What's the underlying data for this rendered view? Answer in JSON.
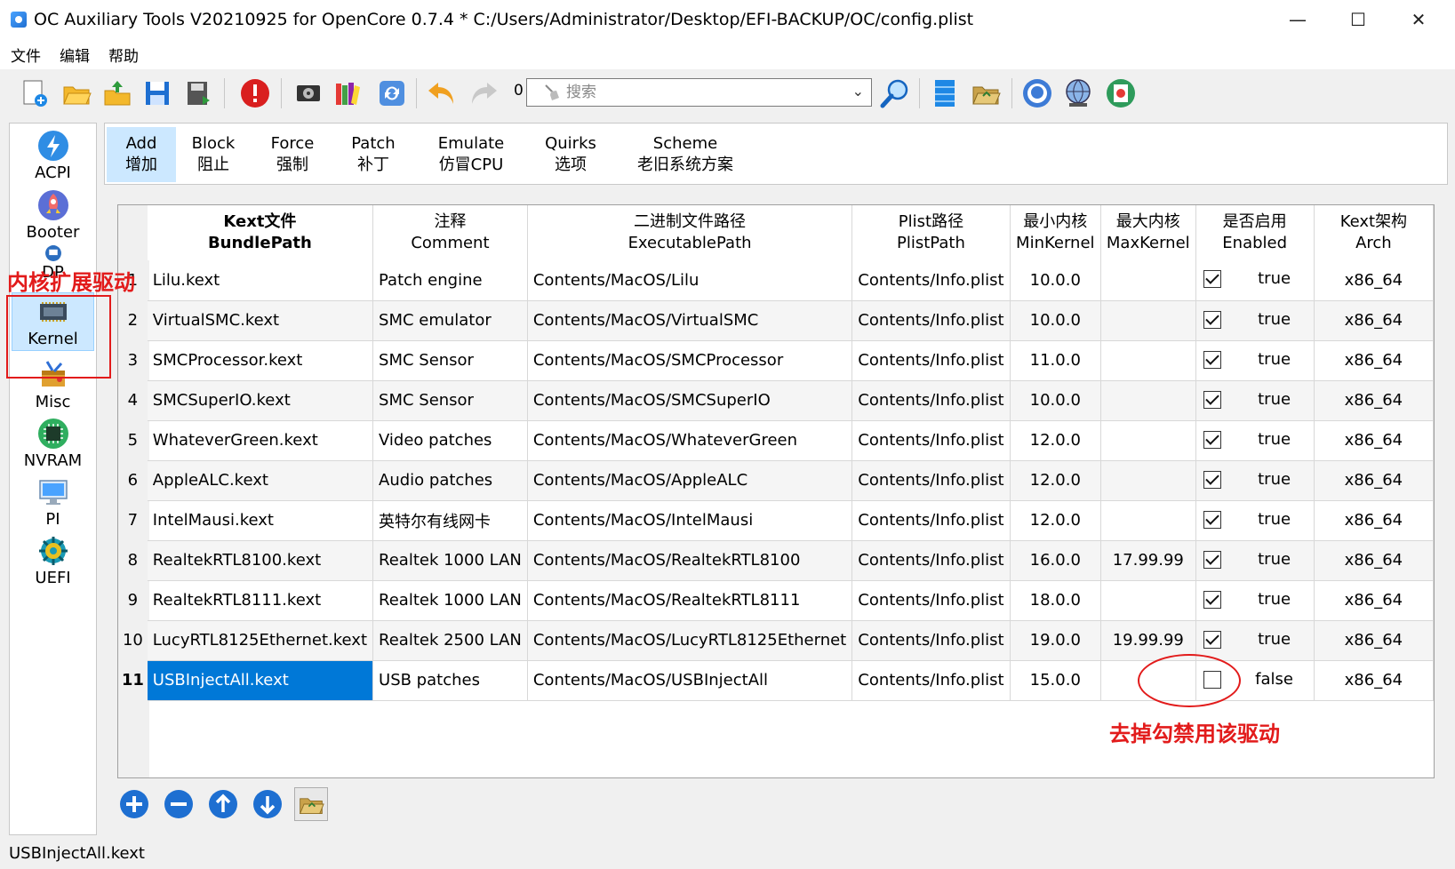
{
  "window": {
    "title": "OC Auxiliary Tools   V20210925 for OpenCore 0.7.4 *  C:/Users/Administrator/Desktop/EFI-BACKUP/OC/config.plist",
    "minimize": "—",
    "maximize": "☐",
    "close": "✕"
  },
  "menu": [
    "文件",
    "编辑",
    "帮助"
  ],
  "toolbar": {
    "search_count": "0",
    "search_placeholder": "搜索",
    "search_dropdown": "⌄",
    "icons": [
      "new-file-icon",
      "open-folder-icon",
      "upload-folder-icon",
      "save-icon",
      "save-as-icon",
      "stop-icon",
      "disk-icon",
      "library-icon",
      "refresh-icon",
      "undo-icon",
      "redo-icon",
      "search-icon",
      "database-icon",
      "folder-open-icon",
      "github-icon",
      "globe-icon",
      "info-icon"
    ]
  },
  "sidebar": {
    "items": [
      {
        "label": "ACPI",
        "icon": "lightning-icon"
      },
      {
        "label": "Booter",
        "icon": "rocket-icon"
      },
      {
        "label": "DP",
        "icon": "display-icon"
      },
      {
        "label": "Kernel",
        "icon": "chip-icon"
      },
      {
        "label": "Misc",
        "icon": "toolbox-icon"
      },
      {
        "label": "NVRAM",
        "icon": "memory-icon"
      },
      {
        "label": "PI",
        "icon": "monitor-icon"
      },
      {
        "label": "UEFI",
        "icon": "uefi-icon"
      }
    ],
    "active": "Kernel"
  },
  "tabs": [
    {
      "en": "Add",
      "zh": "增加"
    },
    {
      "en": "Block",
      "zh": "阻止"
    },
    {
      "en": "Force",
      "zh": "强制"
    },
    {
      "en": "Patch",
      "zh": "补丁"
    },
    {
      "en": "Emulate",
      "zh": "仿冒CPU"
    },
    {
      "en": "Quirks",
      "zh": "选项"
    },
    {
      "en": "Scheme",
      "zh": "老旧系统方案"
    }
  ],
  "table": {
    "headers": [
      {
        "zh": "Kext文件",
        "en": "BundlePath"
      },
      {
        "zh": "注释",
        "en": "Comment"
      },
      {
        "zh": "二进制文件路径",
        "en": "ExecutablePath"
      },
      {
        "zh": "Plist路径",
        "en": "PlistPath"
      },
      {
        "zh": "最小内核",
        "en": "MinKernel"
      },
      {
        "zh": "最大内核",
        "en": "MaxKernel"
      },
      {
        "zh": "是否启用",
        "en": "Enabled"
      },
      {
        "zh": "Kext架构",
        "en": "Arch"
      }
    ],
    "rows": [
      {
        "n": "1",
        "bundle": "Lilu.kext",
        "comment": "Patch engine",
        "exec": "Contents/MacOS/Lilu",
        "plist": "Contents/Info.plist",
        "min": "10.0.0",
        "max": "",
        "enabled": "true",
        "checked": true,
        "arch": "x86_64"
      },
      {
        "n": "2",
        "bundle": "VirtualSMC.kext",
        "comment": "SMC emulator",
        "exec": "Contents/MacOS/VirtualSMC",
        "plist": "Contents/Info.plist",
        "min": "10.0.0",
        "max": "",
        "enabled": "true",
        "checked": true,
        "arch": "x86_64"
      },
      {
        "n": "3",
        "bundle": "SMCProcessor.kext",
        "comment": "SMC Sensor",
        "exec": "Contents/MacOS/SMCProcessor",
        "plist": "Contents/Info.plist",
        "min": "11.0.0",
        "max": "",
        "enabled": "true",
        "checked": true,
        "arch": "x86_64"
      },
      {
        "n": "4",
        "bundle": "SMCSuperIO.kext",
        "comment": "SMC Sensor",
        "exec": "Contents/MacOS/SMCSuperIO",
        "plist": "Contents/Info.plist",
        "min": "10.0.0",
        "max": "",
        "enabled": "true",
        "checked": true,
        "arch": "x86_64"
      },
      {
        "n": "5",
        "bundle": "WhateverGreen.kext",
        "comment": "Video patches",
        "exec": "Contents/MacOS/WhateverGreen",
        "plist": "Contents/Info.plist",
        "min": "12.0.0",
        "max": "",
        "enabled": "true",
        "checked": true,
        "arch": "x86_64"
      },
      {
        "n": "6",
        "bundle": "AppleALC.kext",
        "comment": "Audio patches",
        "exec": "Contents/MacOS/AppleALC",
        "plist": "Contents/Info.plist",
        "min": "12.0.0",
        "max": "",
        "enabled": "true",
        "checked": true,
        "arch": "x86_64"
      },
      {
        "n": "7",
        "bundle": "IntelMausi.kext",
        "comment": "英特尔有线网卡",
        "exec": "Contents/MacOS/IntelMausi",
        "plist": "Contents/Info.plist",
        "min": "12.0.0",
        "max": "",
        "enabled": "true",
        "checked": true,
        "arch": "x86_64"
      },
      {
        "n": "8",
        "bundle": "RealtekRTL8100.kext",
        "comment": "Realtek 1000 LAN",
        "exec": "Contents/MacOS/RealtekRTL8100",
        "plist": "Contents/Info.plist",
        "min": "16.0.0",
        "max": "17.99.99",
        "enabled": "true",
        "checked": true,
        "arch": "x86_64"
      },
      {
        "n": "9",
        "bundle": "RealtekRTL8111.kext",
        "comment": "Realtek 1000 LAN",
        "exec": "Contents/MacOS/RealtekRTL8111",
        "plist": "Contents/Info.plist",
        "min": "18.0.0",
        "max": "",
        "enabled": "true",
        "checked": true,
        "arch": "x86_64"
      },
      {
        "n": "10",
        "bundle": "LucyRTL8125Ethernet.kext",
        "comment": "Realtek 2500 LAN",
        "exec": "Contents/MacOS/LucyRTL8125Ethernet",
        "plist": "Contents/Info.plist",
        "min": "19.0.0",
        "max": "19.99.99",
        "enabled": "true",
        "checked": true,
        "arch": "x86_64"
      },
      {
        "n": "11",
        "bundle": "USBInjectAll.kext",
        "comment": "USB   patches",
        "exec": "Contents/MacOS/USBInjectAll",
        "plist": "Contents/Info.plist",
        "min": "15.0.0",
        "max": "",
        "enabled": "false",
        "checked": false,
        "arch": "x86_64"
      }
    ],
    "selected_row": "11"
  },
  "annotations": {
    "kernel_note": "内核扩展驱动",
    "disable_note": "去掉勾禁用该驱动",
    "color": "#e21b1b"
  },
  "bottom_buttons": [
    "add-icon",
    "remove-icon",
    "move-up-icon",
    "move-down-icon",
    "open-folder-icon"
  ],
  "status": "USBInjectAll.kext"
}
